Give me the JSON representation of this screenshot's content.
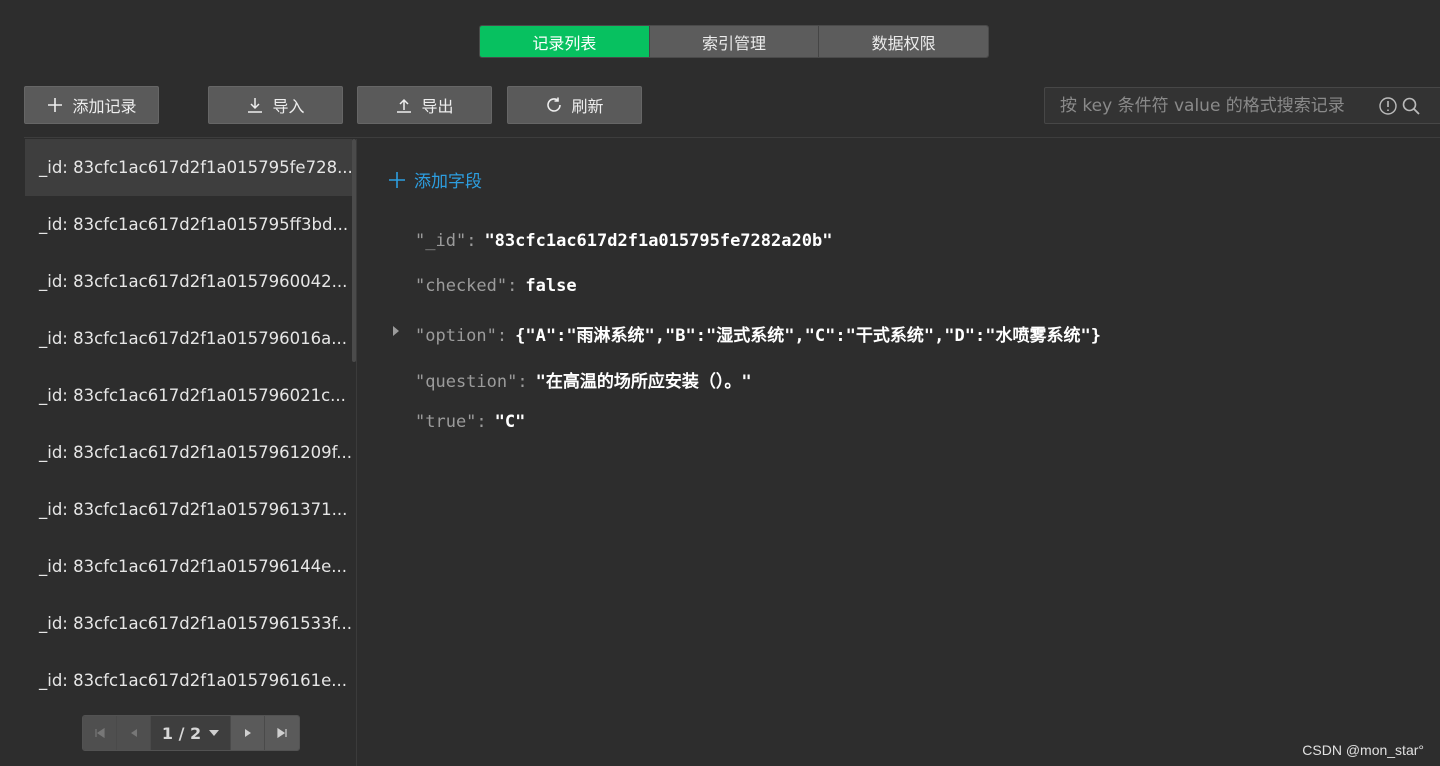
{
  "tabs": [
    {
      "label": "记录列表",
      "active": true
    },
    {
      "label": "索引管理",
      "active": false
    },
    {
      "label": "数据权限",
      "active": false
    }
  ],
  "toolbar": {
    "add_record": "添加记录",
    "import": "导入",
    "export": "导出",
    "refresh": "刷新"
  },
  "search": {
    "placeholder": "按 key 条件符 value 的格式搜索记录",
    "value": ""
  },
  "records": [
    "_id: 83cfc1ac617d2f1a015795fe728...",
    "_id: 83cfc1ac617d2f1a015795ff3bd...",
    "_id: 83cfc1ac617d2f1a0157960042...",
    "_id: 83cfc1ac617d2f1a015796016a...",
    "_id: 83cfc1ac617d2f1a015796021c...",
    "_id: 83cfc1ac617d2f1a0157961209f...",
    "_id: 83cfc1ac617d2f1a0157961371...",
    "_id: 83cfc1ac617d2f1a015796144e...",
    "_id: 83cfc1ac617d2f1a0157961533f...",
    "_id: 83cfc1ac617d2f1a015796161e..."
  ],
  "pager": {
    "label": "1 / 2"
  },
  "detail": {
    "add_field": "添加字段",
    "fields": [
      {
        "key": "\"_id\"",
        "value": "\"83cfc1ac617d2f1a015795fe7282a20b\""
      },
      {
        "key": "\"checked\"",
        "value": "false"
      },
      {
        "key": "\"option\"",
        "value": "{\"A\":\"雨淋系统\",\"B\":\"湿式系统\",\"C\":\"干式系统\",\"D\":\"水喷雾系统\"}"
      },
      {
        "key": "\"question\"",
        "value": "\"在高温的场所应安装（）。\""
      },
      {
        "key": "\"true\"",
        "value": "\"C\""
      }
    ]
  },
  "watermark": "CSDN @mon_star°",
  "colors": {
    "accent": "#07c160",
    "link": "#2d9ee0",
    "background": "#2d2d2d"
  }
}
